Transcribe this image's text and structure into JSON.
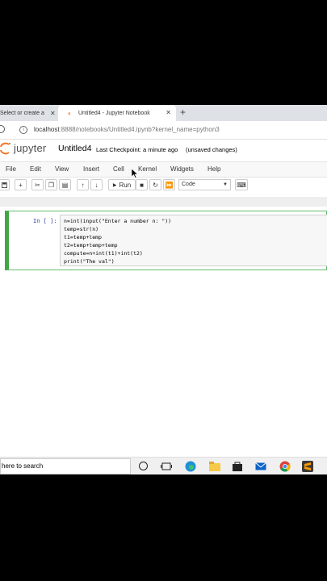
{
  "browser": {
    "tabs": [
      {
        "label": "Select or create a"
      },
      {
        "label": "Untitled4 - Jupyter Notebook"
      }
    ],
    "url_host": "localhost",
    "url_rest": ":8888/notebooks/Untitled4.ipynb?kernel_name=python3"
  },
  "jupyter": {
    "logo_text": "jupyter",
    "notebook_title": "Untitled4",
    "checkpoint": "Last Checkpoint: a minute ago",
    "save_status": "(unsaved changes)"
  },
  "menu": [
    "File",
    "Edit",
    "View",
    "Insert",
    "Cell",
    "Kernel",
    "Widgets",
    "Help"
  ],
  "toolbar": {
    "run_label": "Run",
    "cell_type": "Code"
  },
  "cell": {
    "prompt": "In [ ]:",
    "code_lines": [
      "n=int(input(\"Enter a number n: \"))",
      "temp=str(n)",
      "t1=temp+temp",
      "t2=temp+temp+temp",
      "compute=n+int(t1)+int(t2)",
      "print(\"The val\")"
    ]
  },
  "taskbar": {
    "search_placeholder": "here to search"
  },
  "colors": {
    "accent_orange": "#f37626",
    "cell_border_green": "#42a546"
  },
  "icons": [
    "reload-icon",
    "info-icon",
    "close-icon",
    "plus-icon",
    "save-icon",
    "scissors-icon",
    "copy-icon",
    "paste-icon",
    "arrow-up-icon",
    "arrow-down-icon",
    "stop-icon",
    "restart-icon",
    "fast-forward-icon",
    "keyboard-icon",
    "cortana-icon",
    "task-view-icon",
    "edge-icon",
    "file-explorer-icon",
    "store-icon",
    "mail-icon",
    "chrome-icon",
    "sublime-icon"
  ]
}
